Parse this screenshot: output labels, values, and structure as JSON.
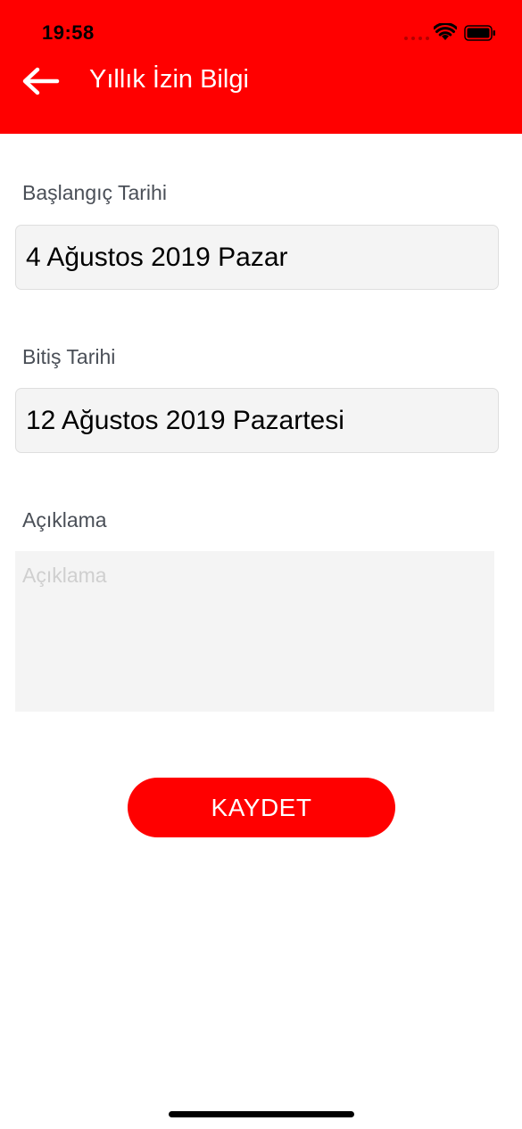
{
  "status_bar": {
    "time": "19:58",
    "signal_icon": "signal-dots-icon",
    "wifi_icon": "wifi-icon",
    "battery_icon": "battery-icon"
  },
  "header": {
    "back_icon": "arrow-left-icon",
    "title": "Yıllık İzin Bilgi",
    "background_color": "#ff0000"
  },
  "form": {
    "start_date": {
      "label": "Başlangıç Tarihi",
      "value": "4 Ağustos 2019 Pazar"
    },
    "end_date": {
      "label": "Bitiş Tarihi",
      "value": "12 Ağustos 2019 Pazartesi"
    },
    "description": {
      "label": "Açıklama",
      "placeholder": "Açıklama",
      "value": ""
    }
  },
  "save_button": {
    "label": "KAYDET",
    "color": "#ff0000"
  }
}
